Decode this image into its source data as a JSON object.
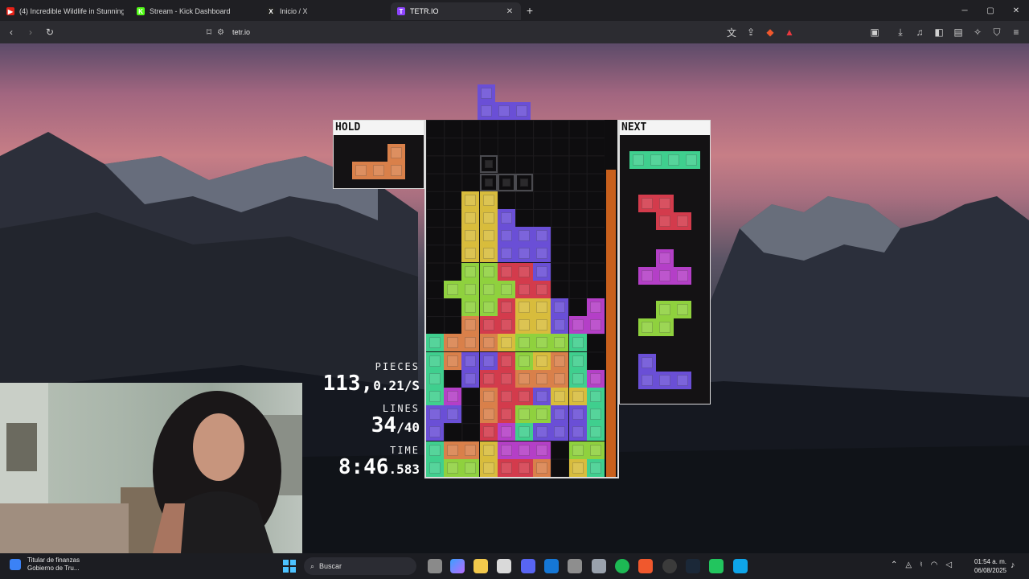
{
  "browser": {
    "tabs": [
      {
        "label": "(4) Incredible Wildlife in Stunning 16K",
        "icon": "youtube-icon",
        "color": "#e62117",
        "glyph": "▶",
        "active": false
      },
      {
        "label": "Stream - Kick Dashboard",
        "icon": "kick-icon",
        "color": "#53fc18",
        "glyph": "K",
        "active": false
      },
      {
        "label": "Inicio / X",
        "icon": "x-icon",
        "color": "#222222",
        "glyph": "X",
        "active": false
      },
      {
        "label": "TETR.IO",
        "icon": "tetrio-icon",
        "color": "#8e44ff",
        "glyph": "T",
        "active": true
      }
    ],
    "address": "tetr.io"
  },
  "game": {
    "hold_label": "HOLD",
    "next_label": "NEXT",
    "stats": {
      "pieces_label": "PIECES",
      "pieces_value": "113,",
      "pieces_rate": "0.21/S",
      "lines_label": "LINES",
      "lines_value": "34",
      "lines_total": "/40",
      "time_label": "TIME",
      "time_value": "8:46",
      "time_ms": ".583"
    },
    "colors": {
      "Z": "#d33b4c",
      "S": "#8fd13e",
      "L": "#d9804a",
      "J": "#6a4fd6",
      "T": "#b43fc7",
      "I": "#3fcf8e",
      "O": "#d8bc3c",
      "G": "#2a2a2e"
    },
    "rows": [
      "..........",
      "..........",
      "..........",
      "..........",
      "..OO......",
      "..OOJ.....",
      "..OOJJJ...",
      "..OOJJJ...",
      "..SSZZJ...",
      ".SSSSZZ...",
      "..SSZOOJ.T",
      "..LZZOOJTT",
      "ILLLOSSSI.",
      "ILJJZSOLI.",
      "I.JZZLLLIT",
      "IT.LZZJOOI",
      "JJ.LZSSJJI",
      "J..ZTIJJJI",
      "ILLOTTT.SS",
      "ISSOZZL.OI"
    ],
    "ghost": [
      [
        3,
        2
      ],
      [
        3,
        3
      ],
      [
        4,
        3
      ],
      [
        5,
        3
      ]
    ],
    "falling_piece": "J",
    "hold_piece": "L",
    "next_queue": [
      "I",
      "Z",
      "T",
      "S",
      "J"
    ],
    "meter_level": 0.86
  },
  "taskbar": {
    "notification_title": "Titular de finanzas",
    "notification_subtitle": "Gobierno de Tru...",
    "search_label": "Buscar",
    "time": "01:54 a. m.",
    "date": "06/08/2025"
  }
}
